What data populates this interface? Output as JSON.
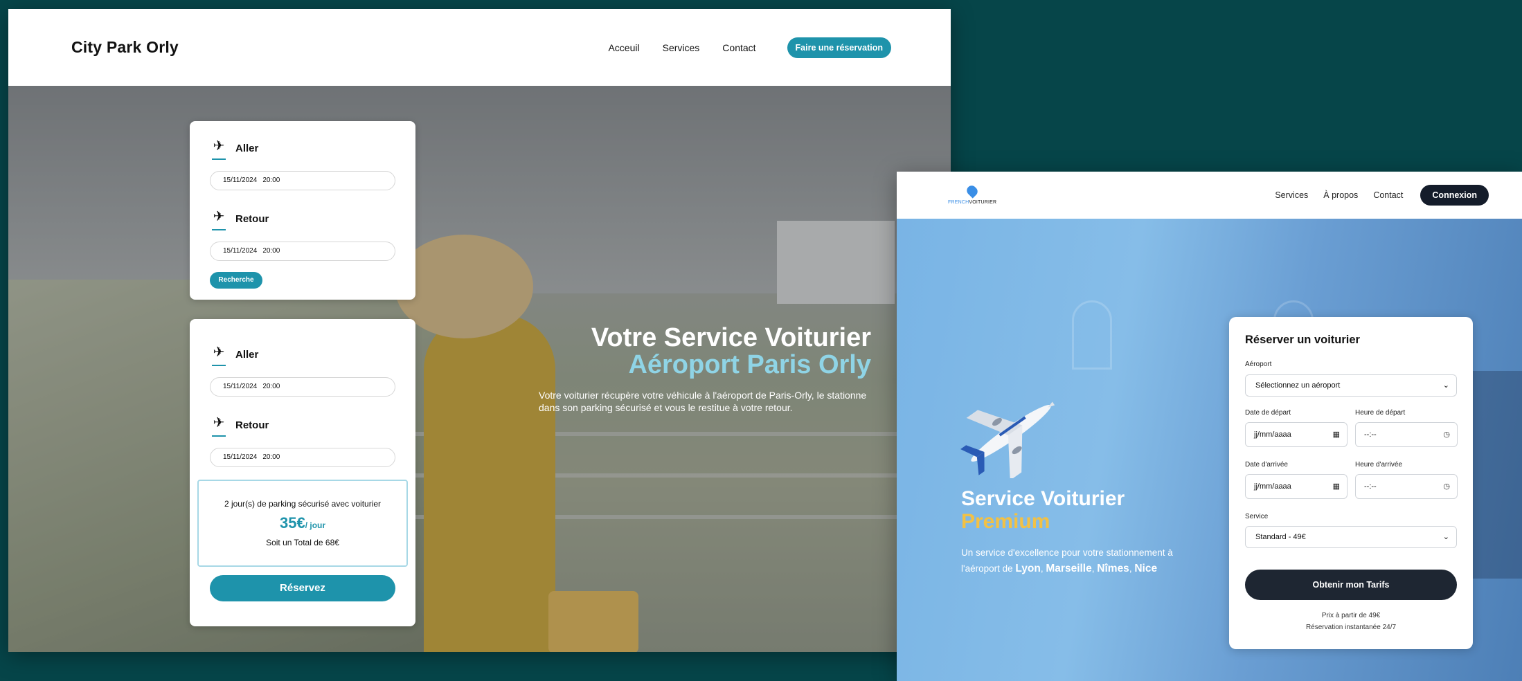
{
  "mockup1": {
    "logo": "City Park Orly",
    "nav": [
      "Acceuil",
      "Services",
      "Contact"
    ],
    "cta": "Faire une réservation",
    "hero": {
      "title_line1": "Votre Service Voiturier",
      "title_line2": "Aéroport Paris Orly",
      "subtitle": "Votre voiturier récupère votre véhicule à l'aéroport de Paris-Orly, le stationne dans son parking sécurisé et vous le restitue à votre retour."
    },
    "search_card": {
      "aller_label": "Aller",
      "aller_date": "15/11/2024",
      "aller_time": "20:00",
      "retour_label": "Retour",
      "retour_date": "15/11/2024",
      "retour_time": "20:00",
      "button": "Recherche"
    },
    "result_card": {
      "aller_label": "Aller",
      "aller_date": "15/11/2024",
      "aller_time": "20:00",
      "retour_label": "Retour",
      "retour_date": "15/11/2024",
      "retour_time": "20:00",
      "summary": "2 jour(s) de parking sécurisé avec voiturier",
      "price": "35€",
      "price_unit": "/ jour",
      "total": "Soit un Total de 68€",
      "button": "Réservez"
    }
  },
  "mockup2": {
    "logo_part1": "FRENCH",
    "logo_part2": "VOITURIER",
    "nav": [
      "Services",
      "À propos",
      "Contact"
    ],
    "connect_button": "Connexion",
    "hero": {
      "title_line1": "Service Voiturier",
      "title_line2": "Premium",
      "subtitle_prefix": "Un service d'excellence pour votre stationnement à l'aéroport de",
      "cities": [
        "Lyon",
        "Marseille",
        "Nîmes",
        "Nice"
      ],
      "separator": ","
    },
    "form": {
      "title": "Réserver un voiturier",
      "airport_label": "Aéroport",
      "airport_value": "Sélectionnez un aéroport",
      "departure_date_label": "Date de départ",
      "departure_date_placeholder": "jj/mm/aaaa",
      "departure_time_label": "Heure de départ",
      "departure_time_placeholder": "--:--",
      "arrival_date_label": "Date d'arrivée",
      "arrival_date_placeholder": "jj/mm/aaaa",
      "arrival_time_label": "Heure d'arrivée",
      "arrival_time_placeholder": "--:--",
      "service_label": "Service",
      "service_value": "Standard - 49€",
      "submit": "Obtenir mon Tarifs",
      "footnote1": "Prix à partir de 49€",
      "footnote2": "Réservation instantanée 24/7"
    }
  },
  "colors": {
    "background": "#064549",
    "accent_teal": "#1e93ab",
    "accent_light_blue": "#8fd4e6",
    "premium_yellow": "#f2c145",
    "dark_button": "#141c2a"
  },
  "icons": {
    "takeoff": "airplane-takeoff-icon",
    "landing": "airplane-landing-icon",
    "calendar": "calendar-icon",
    "clock": "clock-icon",
    "chevron": "chevron-down-icon"
  }
}
